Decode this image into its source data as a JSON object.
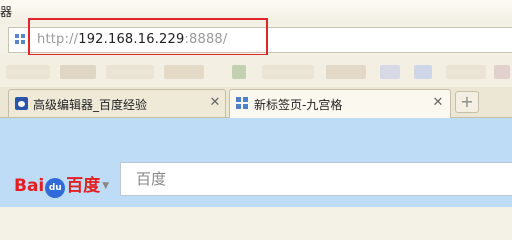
{
  "window": {
    "title_fragment": "器"
  },
  "address_bar": {
    "scheme": "http://",
    "host": "192.168.16.229",
    "port": ":8888/"
  },
  "tabs": [
    {
      "label": "高级编辑器_百度经验",
      "icon": "baidu-paw-icon",
      "active": false
    },
    {
      "label": "新标签页-九宫格",
      "icon": "grid-icon",
      "active": true
    }
  ],
  "new_tab_label": "+",
  "baidu": {
    "logo_bai": "Bai",
    "logo_du": "du",
    "logo_cn": "百度",
    "engine_arrow": "▼",
    "search_placeholder": "百度"
  },
  "colors": {
    "highlight": "#e0262a",
    "page_background": "#bfdcf7",
    "baidu_red": "#e21f1f",
    "baidu_blue": "#2f6bd9"
  }
}
